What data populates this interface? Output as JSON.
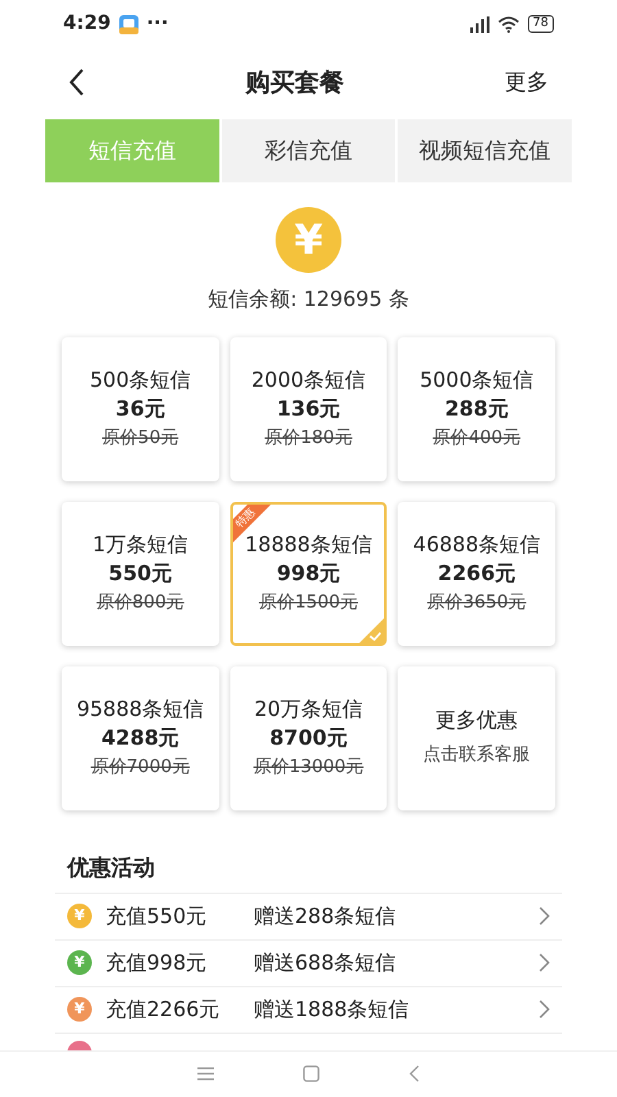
{
  "status_bar": {
    "time": "4:29",
    "dots": "···",
    "battery": "78"
  },
  "header": {
    "title": "购买套餐",
    "action": "更多"
  },
  "tabs": [
    {
      "label": "短信充值",
      "selected": true
    },
    {
      "label": "彩信充值",
      "selected": false
    },
    {
      "label": "视频短信充值",
      "selected": false
    }
  ],
  "balance": {
    "symbol": "¥",
    "text": "短信余额: 129695 条"
  },
  "packages": [
    {
      "kind": "package",
      "name": "500条短信",
      "price": "36元",
      "original": "原价50元",
      "selected": false
    },
    {
      "kind": "package",
      "name": "2000条短信",
      "price": "136元",
      "original": "原价180元",
      "selected": false
    },
    {
      "kind": "package",
      "name": "5000条短信",
      "price": "288元",
      "original": "原价400元",
      "selected": false
    },
    {
      "kind": "package",
      "name": "1万条短信",
      "price": "550元",
      "original": "原价800元",
      "selected": false
    },
    {
      "kind": "package",
      "name": "18888条短信",
      "price": "998元",
      "original": "原价1500元",
      "selected": true,
      "badge": "特惠"
    },
    {
      "kind": "package",
      "name": "46888条短信",
      "price": "2266元",
      "original": "原价3650元",
      "selected": false
    },
    {
      "kind": "package",
      "name": "95888条短信",
      "price": "4288元",
      "original": "原价7000元",
      "selected": false
    },
    {
      "kind": "package",
      "name": "20万条短信",
      "price": "8700元",
      "original": "原价13000元",
      "selected": false
    },
    {
      "kind": "contact",
      "title": "更多优惠",
      "subtitle": "点击联系客服",
      "selected": false
    }
  ],
  "promotions": {
    "title": "优惠活动",
    "items": [
      {
        "symbol": "¥",
        "color": "#f4b93a",
        "amount": "充值550元",
        "gift": "赠送288条短信"
      },
      {
        "symbol": "¥",
        "color": "#5cb54f",
        "amount": "充值998元",
        "gift": "赠送688条短信"
      },
      {
        "symbol": "¥",
        "color": "#f0955a",
        "amount": "充值2266元",
        "gift": "赠送1888条短信"
      },
      {
        "color": "#e8708a"
      }
    ]
  }
}
